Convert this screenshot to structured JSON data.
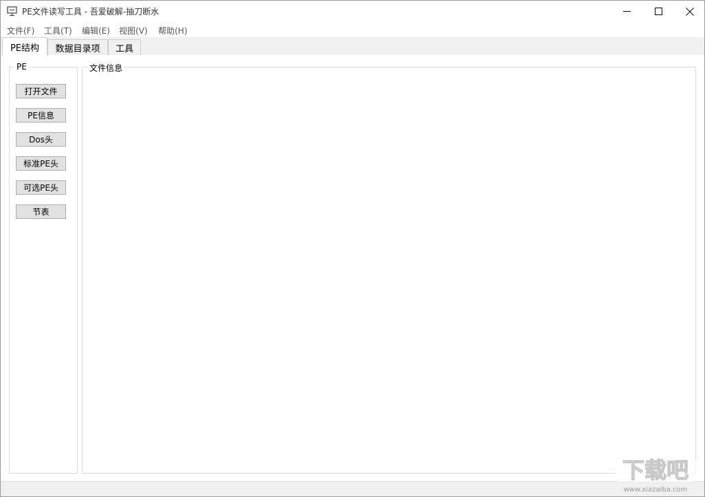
{
  "window": {
    "title": "PE文件读写工具 - 吾爱破解-抽刀断水"
  },
  "menu": [
    "文件(F)",
    "工具(T)",
    "编辑(E)",
    "视图(V)",
    "帮助(H)"
  ],
  "tabs": [
    "PE结构",
    "数据目录项",
    "工具"
  ],
  "left_group": {
    "title": "PE",
    "buttons": [
      "打开文件",
      "PE信息",
      "Dos头",
      "标准PE头",
      "可选PE头",
      "节表"
    ]
  },
  "right_group": {
    "title": "文件信息"
  },
  "watermark": {
    "text": "下载吧",
    "url": "www.xiazaiba.com"
  },
  "colors": {
    "chrome": "#f0f0f0",
    "button_face": "#e1e1e1",
    "button_border": "#adadad"
  }
}
